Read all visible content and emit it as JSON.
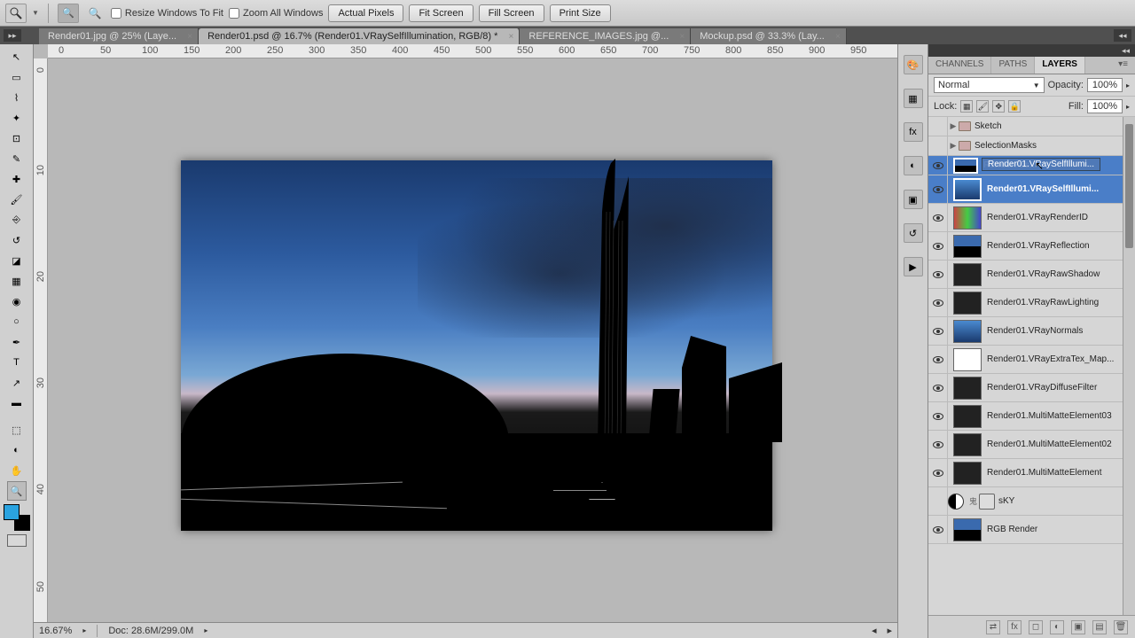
{
  "options": {
    "resize_windows": "Resize Windows To Fit",
    "zoom_all": "Zoom All Windows",
    "actual_pixels": "Actual Pixels",
    "fit_screen": "Fit Screen",
    "fill_screen": "Fill Screen",
    "print_size": "Print Size"
  },
  "tabs": [
    {
      "label": "Render01.jpg @ 25% (Laye...",
      "active": false
    },
    {
      "label": "Render01.psd @ 16.7% (Render01.VRaySelfIllumination, RGB/8) *",
      "active": true
    },
    {
      "label": "REFERENCE_IMAGES.jpg @...",
      "active": false
    },
    {
      "label": "Mockup.psd @ 33.3% (Lay...",
      "active": false
    }
  ],
  "ruler_marks": [
    "0",
    "50",
    "100",
    "150",
    "200",
    "250",
    "300",
    "350",
    "400",
    "450",
    "500",
    "550",
    "600",
    "650",
    "700",
    "750",
    "800",
    "850",
    "900",
    "950"
  ],
  "status": {
    "zoom": "16.67%",
    "doc": "Doc: 28.6M/299.0M"
  },
  "panel_tabs": {
    "channels": "CHANNELS",
    "paths": "PATHS",
    "layers": "LAYERS"
  },
  "blend": {
    "mode": "Normal",
    "opacity_label": "Opacity:",
    "opacity": "100%",
    "lock_label": "Lock:",
    "fill_label": "Fill:",
    "fill": "100%"
  },
  "drag_label": "Render01.VRaySelfIllumi...",
  "layers": [
    {
      "type": "group",
      "name": "Sketch",
      "eye": false
    },
    {
      "type": "group",
      "name": "SelectionMasks",
      "eye": false
    },
    {
      "type": "drop",
      "name": "Render01.VRaySelfIllumi..."
    },
    {
      "type": "layer",
      "name": "Render01.VRaySelfIllumi...",
      "thumb": "blue-t",
      "eye": true,
      "selected": true
    },
    {
      "type": "layer",
      "name": "Render01.VRayRenderID",
      "thumb": "id-t",
      "eye": true
    },
    {
      "type": "layer",
      "name": "Render01.VRayReflection",
      "thumb": "sky-t",
      "eye": true
    },
    {
      "type": "layer",
      "name": "Render01.VRayRawShadow",
      "thumb": "",
      "eye": true
    },
    {
      "type": "layer",
      "name": "Render01.VRayRawLighting",
      "thumb": "",
      "eye": true
    },
    {
      "type": "layer",
      "name": "Render01.VRayNormals",
      "thumb": "blue-t",
      "eye": true
    },
    {
      "type": "layer",
      "name": "Render01.VRayExtraTex_Map...",
      "thumb": "white-t",
      "eye": true
    },
    {
      "type": "layer",
      "name": "Render01.VRayDiffuseFilter",
      "thumb": "",
      "eye": true
    },
    {
      "type": "layer",
      "name": "Render01.MultiMatteElement03",
      "thumb": "",
      "eye": true
    },
    {
      "type": "layer",
      "name": "Render01.MultiMatteElement02",
      "thumb": "",
      "eye": true
    },
    {
      "type": "layer",
      "name": "Render01.MultiMatteElement",
      "thumb": "",
      "eye": true
    },
    {
      "type": "adj",
      "name": "sKY",
      "eye": false
    },
    {
      "type": "layer",
      "name": "RGB Render",
      "thumb": "sky-t",
      "eye": true
    }
  ]
}
